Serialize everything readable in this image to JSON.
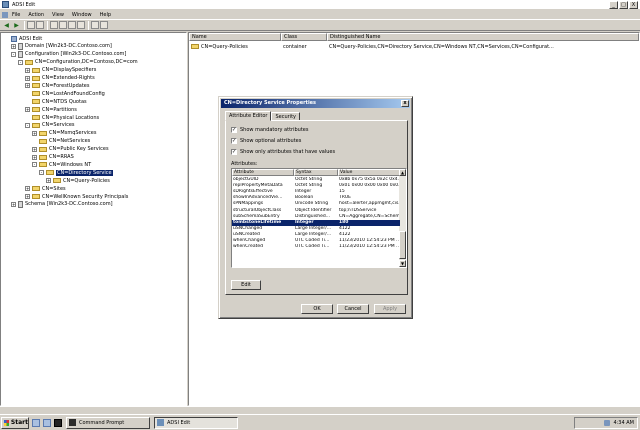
{
  "window": {
    "title": "ADSI Edit",
    "min": "_",
    "max": "□",
    "close": "X"
  },
  "menu": [
    "File",
    "Action",
    "View",
    "Window",
    "Help"
  ],
  "tree": [
    {
      "label": "ADSI Edit",
      "indent": 0,
      "icon": "doc",
      "toggle": ""
    },
    {
      "label": "Domain [Win2k3-DC.Contoso.com]",
      "indent": 1,
      "icon": "srv",
      "toggle": "+"
    },
    {
      "label": "Configuration [Win2k3-DC.Contoso.com]",
      "indent": 1,
      "icon": "srv",
      "toggle": "-"
    },
    {
      "label": "CN=Configuration,DC=Contoso,DC=com",
      "indent": 2,
      "icon": "fold",
      "toggle": "-"
    },
    {
      "label": "CN=DisplaySpecifiers",
      "indent": 3,
      "icon": "fold",
      "toggle": "+"
    },
    {
      "label": "CN=Extended-Rights",
      "indent": 3,
      "icon": "fold",
      "toggle": "+"
    },
    {
      "label": "CN=ForestUpdates",
      "indent": 3,
      "icon": "fold",
      "toggle": "+"
    },
    {
      "label": "CN=LostAndFoundConfig",
      "indent": 3,
      "icon": "fold",
      "toggle": ""
    },
    {
      "label": "CN=NTDS Quotas",
      "indent": 3,
      "icon": "fold",
      "toggle": ""
    },
    {
      "label": "CN=Partitions",
      "indent": 3,
      "icon": "fold",
      "toggle": "+"
    },
    {
      "label": "CN=Physical Locations",
      "indent": 3,
      "icon": "fold",
      "toggle": ""
    },
    {
      "label": "CN=Services",
      "indent": 3,
      "icon": "fold",
      "toggle": "-"
    },
    {
      "label": "CN=MsmqServices",
      "indent": 4,
      "icon": "fold",
      "toggle": "+"
    },
    {
      "label": "CN=NetServices",
      "indent": 4,
      "icon": "fold",
      "toggle": ""
    },
    {
      "label": "CN=Public Key Services",
      "indent": 4,
      "icon": "fold",
      "toggle": "+"
    },
    {
      "label": "CN=RRAS",
      "indent": 4,
      "icon": "fold",
      "toggle": "+"
    },
    {
      "label": "CN=Windows NT",
      "indent": 4,
      "icon": "fold",
      "toggle": "-"
    },
    {
      "label": "CN=Directory Service",
      "indent": 5,
      "icon": "fold",
      "toggle": "-",
      "selected": true
    },
    {
      "label": "CN=Query-Policies",
      "indent": 6,
      "icon": "fold",
      "toggle": "+"
    },
    {
      "label": "CN=Sites",
      "indent": 3,
      "icon": "fold",
      "toggle": "+"
    },
    {
      "label": "CN=WellKnown Security Principals",
      "indent": 3,
      "icon": "fold",
      "toggle": "+"
    },
    {
      "label": "Schema [Win2k3-DC.Contoso.com]",
      "indent": 1,
      "icon": "srv",
      "toggle": "+"
    }
  ],
  "list": {
    "headers": [
      "Name",
      "Class",
      "Distinguished Name"
    ],
    "row": {
      "name": "CN=Query-Policies",
      "class": "container",
      "dn": "CN=Query-Policies,CN=Directory Service,CN=Windows NT,CN=Services,CN=Configurat..."
    }
  },
  "dialog": {
    "title": "CN=Directory Service Properties",
    "close": "x",
    "tabs": [
      "Attribute Editor",
      "Security"
    ],
    "checks": [
      {
        "label": "Show mandatory attributes",
        "checked": true
      },
      {
        "label": "Show optional attributes",
        "checked": true
      },
      {
        "label": "Show only attributes that have values",
        "checked": true
      }
    ],
    "attributes_label": "Attributes:",
    "columns": [
      "Attribute",
      "Syntax",
      "Value"
    ],
    "rows": [
      {
        "a": "objectGUID",
        "s": "Octet String",
        "v": "0x8b 0x75 0x5a 0x2c 0x4..."
      },
      {
        "a": "replPropertyMetaData",
        "s": "Octet String",
        "v": "0x01 0x00 0x00 0x00 0x0..."
      },
      {
        "a": "sDRightsEffective",
        "s": "Integer",
        "v": "15"
      },
      {
        "a": "showInAdvancedVie...",
        "s": "Boolean",
        "v": "TRUE"
      },
      {
        "a": "sPNMappings",
        "s": "Unicode String",
        "v": "host=alerter,appmgmt,cis..."
      },
      {
        "a": "structuralObjectClass",
        "s": "Object Identifier",
        "v": "top;nTDSService"
      },
      {
        "a": "subSchemaSubEntry",
        "s": "Distinguished...",
        "v": "CN=Aggregate,CN=Schema..."
      },
      {
        "a": "tombstoneLifetime",
        "s": "Integer",
        "v": "180",
        "selected": true
      },
      {
        "a": "uSNChanged",
        "s": "Large Integer/...",
        "v": "4122"
      },
      {
        "a": "uSNCreated",
        "s": "Large Integer/...",
        "v": "4122"
      },
      {
        "a": "whenChanged",
        "s": "UTC Coded Ti...",
        "v": "11/23/2010 12:54:23 PM ..."
      },
      {
        "a": "whenCreated",
        "s": "UTC Coded Ti...",
        "v": "11/23/2010 12:54:23 PM ..."
      }
    ],
    "edit": "Edit",
    "ok": "OK",
    "cancel": "Cancel",
    "apply": "Apply"
  },
  "taskbar": {
    "start": "Start",
    "tasks": [
      {
        "label": "Command Prompt",
        "active": false
      },
      {
        "label": "ADSI Edit",
        "active": true
      }
    ],
    "clock": "4:34 AM"
  }
}
